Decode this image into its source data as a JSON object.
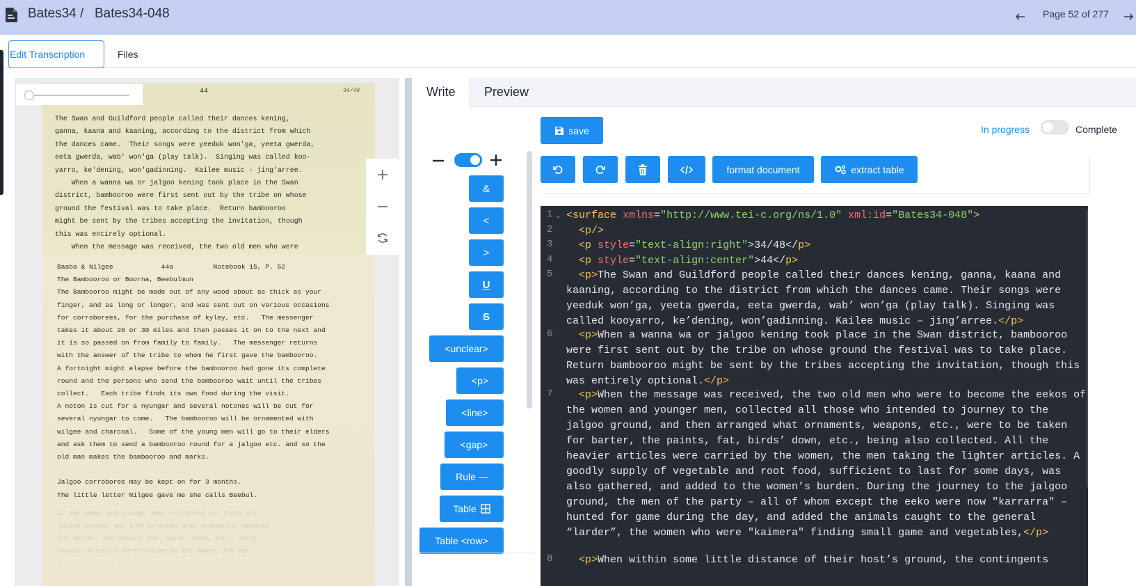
{
  "header": {
    "breadcrumb_collection": "Bates34 /",
    "breadcrumb_document": "Bates34-048",
    "page_indicator": "Page 52 of 277"
  },
  "tabs": {
    "edit_transcription": "Edit Transcription",
    "files": "Files"
  },
  "scan": {
    "page_number": "44",
    "page_ref": "34/48",
    "typed_page_top": "The Swan and Guildford people called their dances kening,\nganna, kaana and kaaning, according to the district from which\nthe dances came.  Their songs were yeeduk won'ga, yeeta gwerda,\neeta gwerda, wab' won'ga (play talk).  Singing was called koo-\nyarro, ke'dening, won'gadinning.  Kailee music - jing'arree.\n    When a wanna wa or jalgoo kening took place in the Swan\ndistrict, bambooroo were first sent out by the tribe on whose\nground the festival was to take place.  Return bambooroo\nmight be sent by the tribes accepting the invitation, though\nthis was entirely optional.\n    When the message was received, the two old men who were",
    "typed_page_insert": "Baaba & Nilgee            44a          Notebook 15, P. 52\nThe Bambooroo or Boorna, Beebulmun\nThe Bambooroo might be made out of any wood about as thick as your\nfinger, and as long or longer, and was sent out on various occasions\nfor corroborees, for the purchase of kyley, etc.   The messenger\ntakes it about 20 or 30 miles and then passes it on to the next and\nit is so passed on from family to family.   The messenger returns\nwith the answer of the tribe to whom he first gave the bambooroo.\nA fortnight might elapse before the bambooroo had gone its complete\nround and the persons who send the bambooroo wait until the tribes\ncollect.   Each tribe finds its own food during the visit.\nA noton is cut for a nyungar and several notones will be cut for\nseveral nyungar to come.   The bambooroo will be ornamented with\nwilgee and charcoal.   Some of the young men will go to their elders\nand ask them to send a bambooroo round for a jalgoo etc. and so the\nold man makes the bambooroo and marks.\n\nJalgoo corroboree may be kept on for 3 months.\nThe little letter Nilgee gave me she calls Beebul.",
    "typed_page_ghost": "of the women and younger men, collected all those who\njalgoo ground, and then arranged what ornaments, weapons\nfor barter, the paints, fat, birds' down, etc., being\nheavier articles were carried by the women, the men\n.      .      .      .      ."
  },
  "editor": {
    "tab_write": "Write",
    "tab_preview": "Preview",
    "save_label": "save",
    "status_in_progress": "In progress",
    "status_complete": "Complete",
    "format_document_label": "format document",
    "extract_table_label": "extract table",
    "palette": {
      "amp": "&",
      "lt": "<",
      "gt": ">",
      "underline": "U",
      "strike": "S",
      "unclear": "<unclear>",
      "p": "<p>",
      "line": "<line>",
      "gap": "<gap>",
      "rule": "Rule ---",
      "table": "Table",
      "table_row": "Table <row>"
    },
    "icons": {
      "undo": "undo-icon",
      "redo": "redo-icon",
      "delete": "trash-icon",
      "code": "code-icon",
      "extract": "gears-icon",
      "save": "floppy-disk-icon"
    },
    "code": {
      "line_numbers": [
        "1",
        "2",
        "3",
        "4",
        "5",
        "6",
        "7",
        "8"
      ],
      "l1_tag_open": "<surface",
      "l1_attr1": "xmlns",
      "l1_val1": "\"http://www.tei-c.org/ns/1.0\"",
      "l1_attr2": "xml:id",
      "l1_val2": "\"Bates34-048\"",
      "l1_close": ">",
      "l2": "<p/>",
      "l3_open": "<p",
      "l3_attr": "style",
      "l3_val": "\"text-align:right\"",
      "l3_text": ">34/48</",
      "l3_close": "p>",
      "l4_open": "<p",
      "l4_attr": "style",
      "l4_val": "\"text-align:center\"",
      "l4_text": ">44</",
      "l4_close": "p>",
      "l5_open": "<p>",
      "l5_text": "The Swan and Guildford people called their dances kening, ganna, kaana and kaaning, according to the district from which the dances came. Their songs were yeeduk won’ga, yeeta gwerda, eeta gwerda, wab’ won’ga (play talk). Singing was called kooyarro, ke’dening, won’gadinning. Kailee music – jing’arree.",
      "l5_close": "</p>",
      "l6_open": "<p>",
      "l6_text": "When a wanna wa or jalgoo kening took place in the Swan district, bambooroo were first sent out by the tribe on whose ground the festival was to take place. Return bambooroo might be sent by the tribes accepting the invitation, though this was entirely optional.",
      "l6_close": "</p>",
      "l7_open": "<p>",
      "l7_text": "When the message was received, the two old men who were to become the eekos of the women and younger men, collected all those who intended to journey to the jalgoo ground, and then arranged what ornaments, weapons, etc., were to be taken for barter, the paints, fat, birds’ down, etc., being also collected. All the heavier articles were carried by the women, the men taking the lighter articles. A goodly supply of vegetable and root food, sufficient to last for some days, was also gathered, and added to the women’s burden. During the journey to the jalgoo ground, the men of the party – all of whom except the eeko were now \"karrarra\" – hunted for game during the day, and added the animals caught to the general “larder”, the women who were \"kaimera\" finding small game and vegetables,",
      "l7_close": "</p>",
      "l8_open": "<p>",
      "l8_text": "When within some little distance of their host’s ground, the contingents"
    }
  }
}
